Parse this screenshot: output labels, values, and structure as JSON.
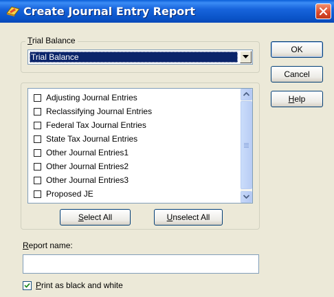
{
  "window": {
    "title": "Create Journal Entry Report",
    "title_icon": "book-report-icon",
    "close_icon": "close-icon"
  },
  "trial_balance": {
    "group_label_accel": "T",
    "group_label_rest": "rial Balance",
    "selected": "Trial Balance"
  },
  "entries": {
    "items": [
      {
        "label": "Adjusting Journal Entries",
        "checked": false
      },
      {
        "label": "Reclassifying Journal Entries",
        "checked": false
      },
      {
        "label": "Federal Tax Journal Entries",
        "checked": false
      },
      {
        "label": "State Tax Journal Entries",
        "checked": false
      },
      {
        "label": "Other Journal Entries1",
        "checked": false
      },
      {
        "label": "Other Journal Entries2",
        "checked": false
      },
      {
        "label": "Other Journal Entries3",
        "checked": false
      },
      {
        "label": "Proposed JE",
        "checked": false
      }
    ],
    "select_all_accel": "S",
    "select_all_rest": "elect All",
    "unselect_all_accel": "U",
    "unselect_all_rest": "nselect All"
  },
  "buttons": {
    "ok": "OK",
    "cancel": "Cancel",
    "help_accel": "H",
    "help_rest": "elp"
  },
  "report_name": {
    "label_accel": "R",
    "label_rest": "eport name:",
    "value": ""
  },
  "print_bw": {
    "checked": true,
    "label_accel": "P",
    "label_rest": "rint as black and white"
  },
  "colors": {
    "titlebar": "#0a54c8",
    "selection": "#0a246a",
    "dialog_bg": "#ece9d8",
    "close_button": "#d9482a"
  }
}
